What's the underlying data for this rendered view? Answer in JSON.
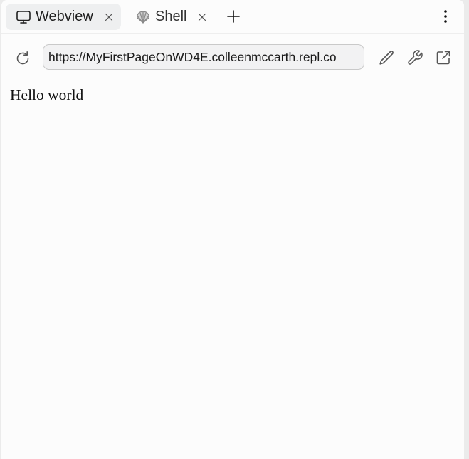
{
  "tabs": [
    {
      "label": "Webview",
      "icon": "monitor-icon",
      "active": true
    },
    {
      "label": "Shell",
      "icon": "shell-icon",
      "active": false
    }
  ],
  "tabbar": {
    "add_tab_icon": "plus-icon",
    "more_icon": "kebab-menu-icon"
  },
  "toolbar": {
    "url": "https://MyFirstPageOnWD4E.colleenmccarth.repl.co",
    "reload_icon": "reload-icon",
    "edit_icon": "pencil-icon",
    "tools_icon": "wrench-icon",
    "open_icon": "external-link-icon"
  },
  "page": {
    "text": "Hello world"
  },
  "colors": {
    "panel_bg": "#fcfcfc",
    "outer_bg": "#ebebeb",
    "active_tab_bg": "#eeeff0",
    "url_bg": "#f2f2f3",
    "url_border": "#c9c9c9"
  }
}
